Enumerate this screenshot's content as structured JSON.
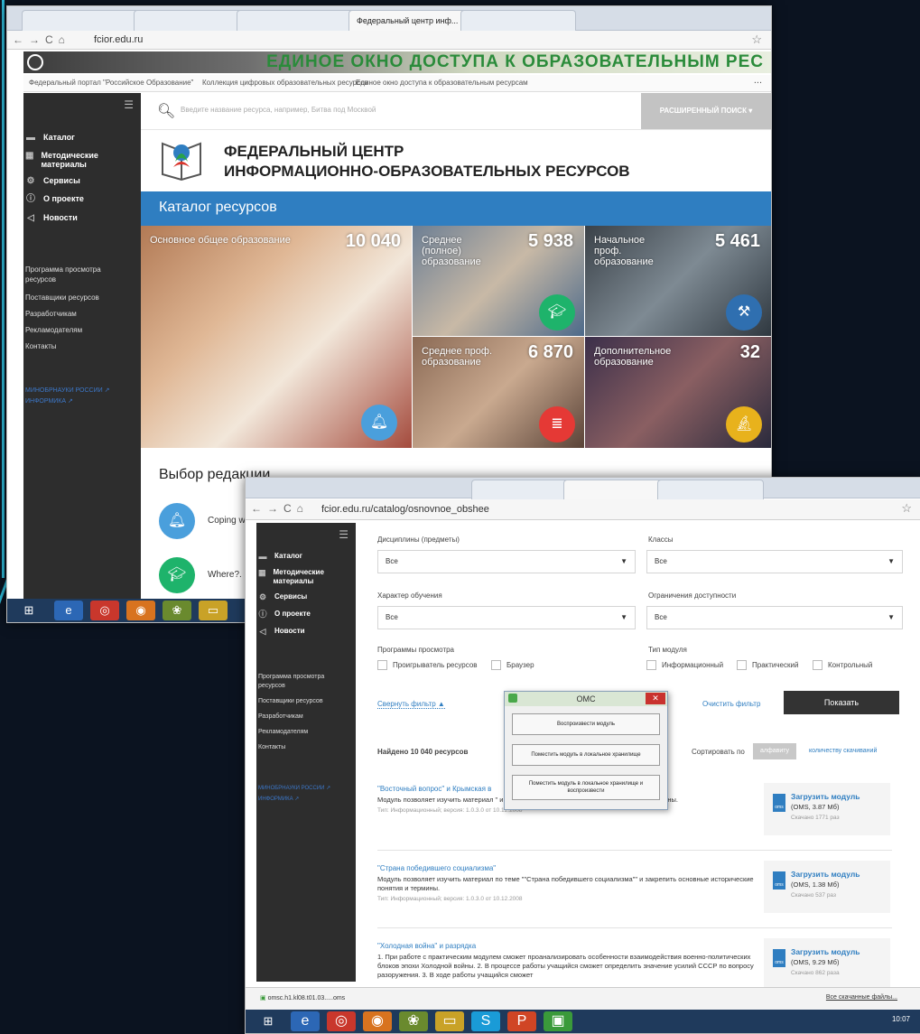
{
  "window1": {
    "tabs": [
      "",
      "",
      "",
      "Федеральный центр инф...",
      ""
    ],
    "url": "fcior.edu.ru",
    "banner_text": "ЕДИНОЕ ОКНО ДОСТУПА К ОБРАЗОВАТЕЛЬНЫМ РЕС",
    "bookmarks": [
      "Федеральный портал \"Российское Образование\"",
      "Коллекция цифровых образовательных ресурсов",
      "Единое окно доступа к образовательным ресурсам",
      "..."
    ],
    "sidebar": {
      "items": [
        {
          "label": "Каталог",
          "icon": "folder-icon"
        },
        {
          "label": "Методические материалы",
          "icon": "calendar-icon"
        },
        {
          "label": "Сервисы",
          "icon": "gear-icon"
        },
        {
          "label": "О проекте",
          "icon": "info-icon"
        },
        {
          "label": "Новости",
          "icon": "megaphone-icon"
        }
      ],
      "links": [
        "Программа просмотра ресурсов",
        "Поставщики ресурсов",
        "Разработчикам",
        "Рекламодателям",
        "Контакты"
      ],
      "external": [
        "МИНОБРНАУКИ РОССИИ",
        "ИНФОРМИКА"
      ]
    },
    "search": {
      "placeholder": "Введите название ресурса, например, Битва под Москвой",
      "advanced": "РАСШИРЕННЫЙ ПОИСК"
    },
    "title_line1": "ФЕДЕРАЛЬНЫЙ ЦЕНТР",
    "title_line2": "ИНФОРМАЦИОННО-ОБРАЗОВАТЕЛЬНЫХ РЕСУРСОВ",
    "catalog_heading": "Каталог ресурсов",
    "tiles": [
      {
        "label": "Основное общее образование",
        "count": "10 040",
        "badge_color": "#4a9fdc"
      },
      {
        "label": "Среднее (полное) образование",
        "count": "5 938",
        "badge_color": "#1eb36b"
      },
      {
        "label": "Начальное проф. образование",
        "count": "5 461",
        "badge_color": "#2f6fb0"
      },
      {
        "label": "Среднее проф. образование",
        "count": "6 870",
        "badge_color": "#e53935"
      },
      {
        "label": "Дополнительное образование",
        "count": "32",
        "badge_color": "#e8b21c"
      }
    ],
    "editor_choice": "Выбор редакции",
    "choice_items": [
      "Coping w",
      "Where?."
    ]
  },
  "window2": {
    "url": "fcior.edu.ru/catalog/osnovnoe_obshee",
    "filters": {
      "disciplines_label": "Дисциплины (предметы)",
      "disciplines_value": "Все",
      "classes_label": "Классы",
      "classes_value": "Все",
      "nature_label": "Характер обучения",
      "nature_value": "Все",
      "access_label": "Ограничения доступности",
      "access_value": "Все",
      "viewers_label": "Программы просмотра",
      "viewer_options": [
        "Проигрыватель ресурсов",
        "Браузер"
      ],
      "module_type_label": "Тип модуля",
      "module_types": [
        "Информационный",
        "Практический",
        "Контрольный"
      ],
      "collapse": "Свернуть фильтр ▲",
      "clear": "Очистить фильтр",
      "show": "Показать"
    },
    "found": "Найдено 10 040 ресурсов",
    "sort_label": "Сортировать по",
    "sort_alpha": "алфавиту",
    "sort_downloads": "количеству скачиваний",
    "results": [
      {
        "title": "\"Восточный вопрос\" и Крымская в",
        "desc": "Модуль позволяет изучить материал                                                     \" и закрепить основные исторические понятия и термины.",
        "meta": "Тип: Информационный; версия: 1.0.3.0 от 10.12.2008",
        "dl": "Загрузить модуль",
        "size": "(OMS, 3.87 Мб)",
        "count": "Скачано 1771 раз"
      },
      {
        "title": "\"Страна победившего социализма\"",
        "desc": "Модуль позволяет изучить материал по теме \"\"Страна победившего социализма\"\" и закрепить основные исторические понятия и термины.",
        "meta": "Тип: Информационный; версия: 1.0.3.0 от 10.12.2008",
        "dl": "Загрузить модуль",
        "size": "(OMS, 1.38 Мб)",
        "count": "Скачано 537 раз"
      },
      {
        "title": "\"Холодная война\" и разрядка",
        "desc": "1. При работе с практическим модулем сможет проанализировать особенности взаимодействия военно-политических блоков эпохи Холодной войны. 2. В процессе работы учащийся сможет определить значение усилий СССР по вопросу разоружения. 3. В ходе работы учащийся сможет",
        "meta": "",
        "dl": "Загрузить модуль",
        "size": "(OMS, 9.29 Мб)",
        "count": "Скачано 862 раза"
      }
    ],
    "dialog": {
      "title": "ОМС",
      "close": "✕",
      "buttons": [
        "Воспроизвести модуль",
        "Поместить модуль в локальное хранилище",
        "Поместить модуль в локальное хранилище и воспроизвести"
      ]
    },
    "download_bar": {
      "file": "omsc.h1.kl08.t01.03.....oms",
      "all": "Все скачанные файлы..."
    },
    "clock": "10:07"
  }
}
